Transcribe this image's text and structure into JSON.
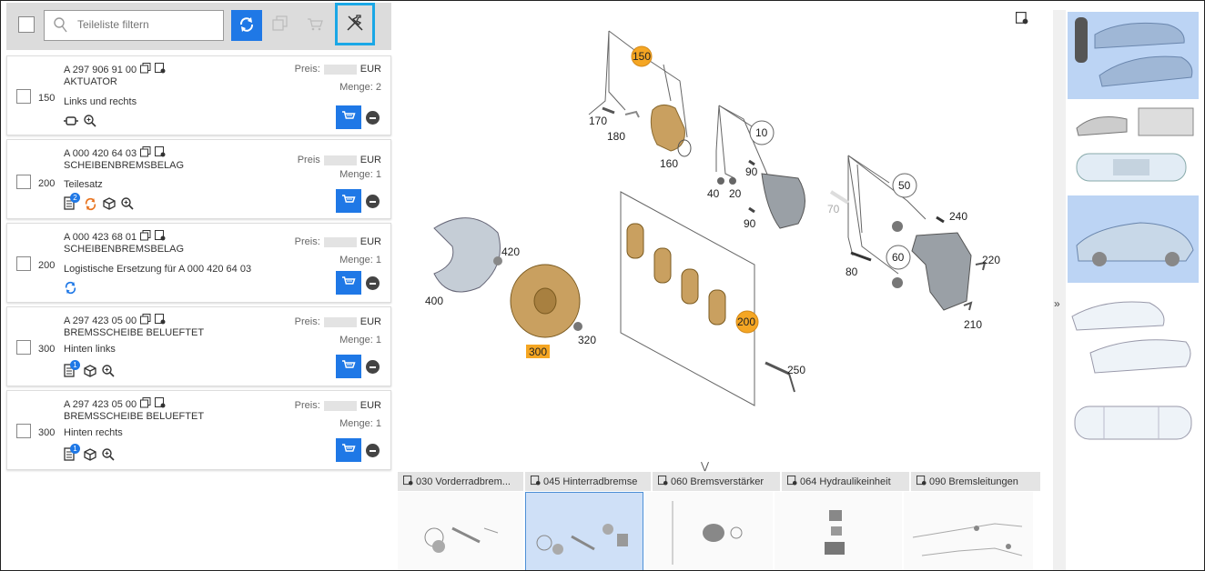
{
  "toolbar": {
    "search_placeholder": "Teileliste filtern",
    "icons": [
      "checkbox",
      "search-icon",
      "refresh-icon",
      "copy-icon",
      "cart-icon",
      "unpin-icon"
    ]
  },
  "items": [
    {
      "part_number": "A 297 906 91 00",
      "name": "AKTUATOR",
      "position": "150",
      "description": "Links und rechts",
      "price_label": "Preis:",
      "currency": "EUR",
      "quantity": "Menge: 2"
    },
    {
      "part_number": "A 000 420 64 03",
      "name": "SCHEIBENBREMSBELAG",
      "position": "200",
      "description": "Teilesatz",
      "price_label": "Preis",
      "currency": "EUR",
      "quantity": "Menge: 1",
      "badge": "2"
    },
    {
      "part_number": "A 000 423 68 01",
      "name": "SCHEIBENBREMSBELAG",
      "position": "200",
      "description": "Logistische Ersetzung für A 000 420 64 03",
      "price_label": "Preis:",
      "currency": "EUR",
      "quantity": "Menge: 1"
    },
    {
      "part_number": "A 297 423 05 00",
      "name": "BREMSSCHEIBE BELUEFTET",
      "position": "300",
      "description": "Hinten links",
      "price_label": "Preis:",
      "currency": "EUR",
      "quantity": "Menge: 1",
      "badge": "1"
    },
    {
      "part_number": "A 297 423 05 00",
      "name": "BREMSSCHEIBE BELUEFTET",
      "position": "300",
      "description": "Hinten rechts",
      "price_label": "Preis:",
      "currency": "EUR",
      "quantity": "Menge: 1",
      "badge": "1"
    }
  ],
  "diagram": {
    "callouts": [
      "150",
      "170",
      "180",
      "160",
      "10",
      "90",
      "40",
      "20",
      "90",
      "70",
      "50",
      "240",
      "60",
      "80",
      "220",
      "210",
      "420",
      "400",
      "300",
      "320",
      "200",
      "250"
    ]
  },
  "tabs": [
    {
      "label": "030 Vorderradbrem..."
    },
    {
      "label": "045 Hinterradbremse"
    },
    {
      "label": "060 Bremsverstärker"
    },
    {
      "label": "064 Hydraulikeinheit"
    },
    {
      "label": "090 Bremsleitungen"
    }
  ],
  "colors": {
    "accent": "#1f78e6",
    "highlight_border": "#1aa7e6",
    "callout_highlight": "#f5a623",
    "selected_bg": "#bcd4f4"
  }
}
